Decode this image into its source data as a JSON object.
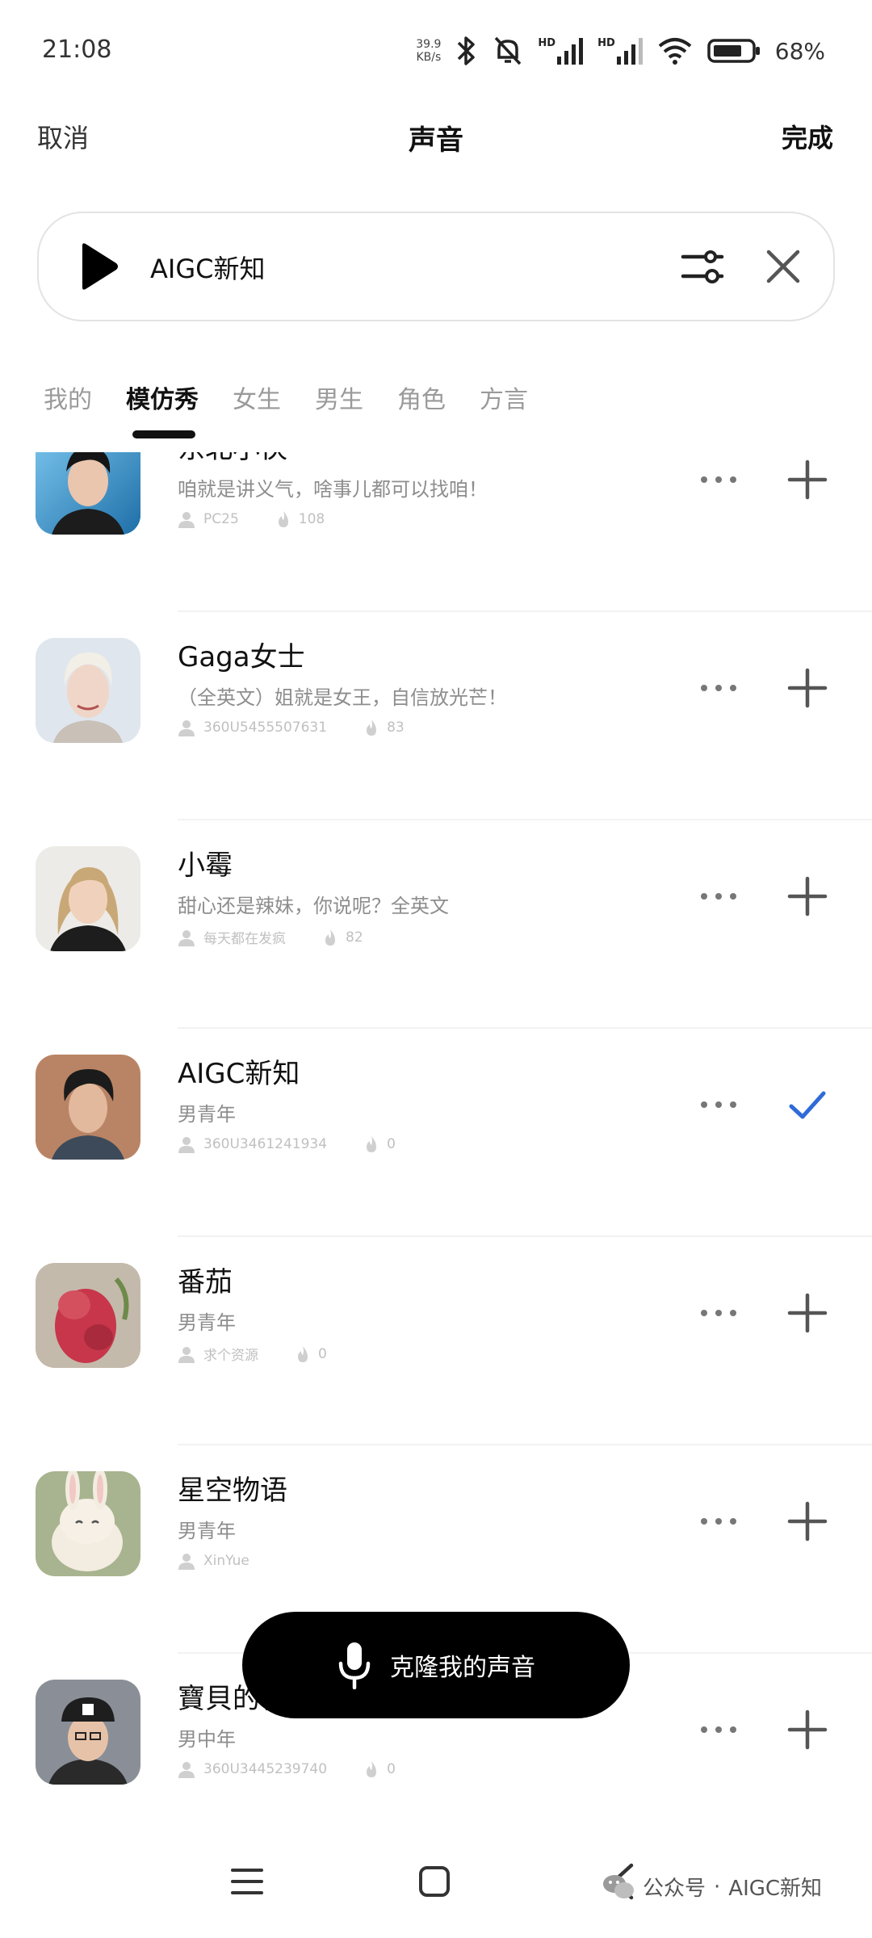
{
  "status_bar": {
    "time": "21:08",
    "net_speed_value": "39.9",
    "net_speed_unit": "KB/s",
    "signal_1_label": "HD",
    "signal_2_label": "HD",
    "battery": "68%"
  },
  "header": {
    "cancel": "取消",
    "title": "声音",
    "done": "完成"
  },
  "voice_bar": {
    "name": "AIGC新知"
  },
  "tabs": [
    {
      "label": "我的"
    },
    {
      "label": "模仿秀"
    },
    {
      "label": "女生"
    },
    {
      "label": "男生"
    },
    {
      "label": "角色"
    },
    {
      "label": "方言"
    }
  ],
  "active_tab": "模仿秀",
  "voices": [
    {
      "name": "东北小伙",
      "desc": "咱就是讲义气，啥事儿都可以找咱！",
      "author": "PC25",
      "likes": "108",
      "selected": false
    },
    {
      "name": "Gaga女士",
      "desc": "（全英文）姐就是女王，自信放光芒！",
      "author": "360U5455507631",
      "likes": "83",
      "selected": false
    },
    {
      "name": "小霉",
      "desc": "甜心还是辣妹，你说呢？全英文",
      "author": "每天都在发疯",
      "likes": "82",
      "selected": false
    },
    {
      "name": "AIGC新知",
      "desc": "男青年",
      "author": "360U3461241934",
      "likes": "0",
      "selected": true
    },
    {
      "name": "番茄",
      "desc": "男青年",
      "author": "求个资源",
      "likes": "0",
      "selected": false
    },
    {
      "name": "星空物语",
      "desc": "男青年",
      "author": "XinYue",
      "likes": "",
      "selected": false
    },
    {
      "name": "寶貝的特色",
      "desc": "男中年",
      "author": "360U3445239740",
      "likes": "0",
      "selected": false
    }
  ],
  "clone_button": {
    "label": "克隆我的声音"
  },
  "watermark": {
    "text_1": "公众号",
    "separator": "·",
    "text_2": "AIGC新知"
  },
  "colors": {
    "accent_check": "#2f6bd8",
    "primary_text": "#111111",
    "secondary_text": "#8d8d8d"
  }
}
